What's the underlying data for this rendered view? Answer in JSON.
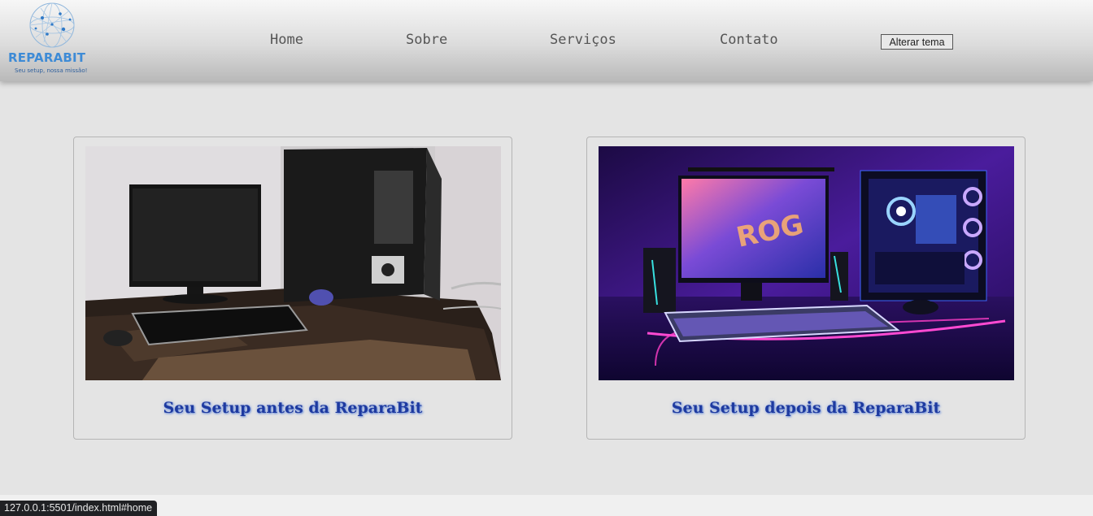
{
  "brand": {
    "name": "REPARABIT",
    "tagline": "Seu setup, nossa missão!",
    "color": "#3e8bd6"
  },
  "nav": {
    "items": [
      {
        "label": "Home"
      },
      {
        "label": "Sobre"
      },
      {
        "label": "Serviços"
      },
      {
        "label": "Contato"
      }
    ],
    "theme_button": "Alterar tema"
  },
  "cards": [
    {
      "caption": "Seu Setup antes da ReparaBit",
      "image": "old-dusty-computer-setup-photo"
    },
    {
      "caption": "Seu Setup depois da ReparaBit",
      "image": "rgb-gaming-setup-photo"
    }
  ],
  "status": {
    "url": "127.0.0.1:5501/index.html#home"
  },
  "colors": {
    "background": "#e4e4e4",
    "caption": "#1e3aa0",
    "nav_text": "#555555"
  }
}
